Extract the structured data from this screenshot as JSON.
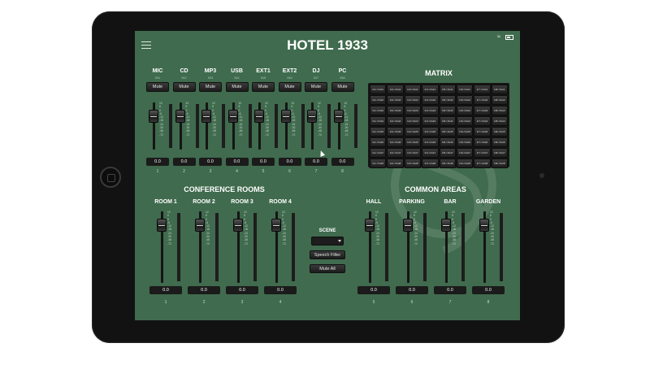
{
  "app": {
    "title": "HOTEL 1933"
  },
  "colors": {
    "screen_bg": "#406b4e",
    "device": "#121212",
    "button": "#2a2a2a"
  },
  "input_channels": [
    {
      "name": "MIC",
      "sub": "IN1",
      "mute": "Mute",
      "value": "0.0",
      "num": "1"
    },
    {
      "name": "CD",
      "sub": "IN2",
      "mute": "Mute",
      "value": "0.0",
      "num": "2"
    },
    {
      "name": "MP3",
      "sub": "IN3",
      "mute": "Mute",
      "value": "0.0",
      "num": "3"
    },
    {
      "name": "USB",
      "sub": "IN4",
      "mute": "Mute",
      "value": "0.0",
      "num": "4"
    },
    {
      "name": "EXT1",
      "sub": "IN5",
      "mute": "Mute",
      "value": "0.0",
      "num": "5"
    },
    {
      "name": "EXT2",
      "sub": "IN6",
      "mute": "Mute",
      "value": "0.0",
      "num": "6"
    },
    {
      "name": "DJ",
      "sub": "IN7",
      "mute": "Mute",
      "value": "0.0",
      "num": "7"
    },
    {
      "name": "PC",
      "sub": "IN8",
      "mute": "Mute",
      "value": "0.0",
      "num": "8"
    }
  ],
  "fader_scale": [
    "12",
    "6",
    "0",
    "-6",
    "-12",
    "-18",
    "-24",
    "-30",
    "-48",
    "-72"
  ],
  "matrix": {
    "title": "MATRIX",
    "rows": [
      [
        "In1->Out1",
        "In2->Out1",
        "In3->Out1",
        "In4->Out1",
        "In5->Out1",
        "In6->Out1",
        "In7->Out1",
        "In8->Out1"
      ],
      [
        "In1->Out2",
        "In2->Out2",
        "In3->Out2",
        "In4->Out2",
        "In5->Out2",
        "In6->Out2",
        "In7->Out2",
        "In8->Out2"
      ],
      [
        "In1->Out3",
        "In2->Out3",
        "In3->Out3",
        "In4->Out3",
        "In5->Out3",
        "In6->Out3",
        "In7->Out3",
        "In8->Out3"
      ],
      [
        "In1->Out4",
        "In2->Out4",
        "In3->Out4",
        "In4->Out4",
        "In5->Out4",
        "In6->Out4",
        "In7->Out4",
        "In8->Out4"
      ],
      [
        "In1->Out5",
        "In2->Out5",
        "In3->Out5",
        "In4->Out5",
        "In5->Out5",
        "In6->Out5",
        "In7->Out5",
        "In8->Out5"
      ],
      [
        "In1->Out6",
        "In2->Out6",
        "In3->Out6",
        "In4->Out6",
        "In5->Out6",
        "In6->Out6",
        "In7->Out6",
        "In8->Out6"
      ],
      [
        "In1->Out7",
        "In2->Out7",
        "In3->Out7",
        "In4->Out7",
        "In5->Out7",
        "In6->Out7",
        "In7->Out7",
        "In8->Out7"
      ],
      [
        "In1->Out8",
        "In2->Out8",
        "In3->Out8",
        "In4->Out8",
        "In5->Out8",
        "In6->Out8",
        "In7->Out8",
        "In8->Out8"
      ]
    ]
  },
  "conference": {
    "title": "CONFERENCE ROOMS",
    "zones": [
      {
        "name": "ROOM 1",
        "value": "0.0",
        "num": "1"
      },
      {
        "name": "ROOM 2",
        "value": "0.0",
        "num": "2"
      },
      {
        "name": "ROOM 3",
        "value": "0.0",
        "num": "3"
      },
      {
        "name": "ROOM 4",
        "value": "0.0",
        "num": "4"
      }
    ]
  },
  "common": {
    "title": "COMMON AREAS",
    "zones": [
      {
        "name": "HALL",
        "value": "0.0",
        "num": "5"
      },
      {
        "name": "PARKING",
        "value": "0.0",
        "num": "6"
      },
      {
        "name": "BAR",
        "value": "0.0",
        "num": "7"
      },
      {
        "name": "GARDEN",
        "value": "0.0",
        "num": "8"
      }
    ]
  },
  "scene": {
    "label": "SCENE",
    "selected": "",
    "speech_filter": "Speech Filter",
    "mute_all": "Mute All"
  },
  "icons": {
    "menu": "hamburger-menu-icon",
    "wifi": "wifi-icon",
    "battery": "battery-icon"
  }
}
